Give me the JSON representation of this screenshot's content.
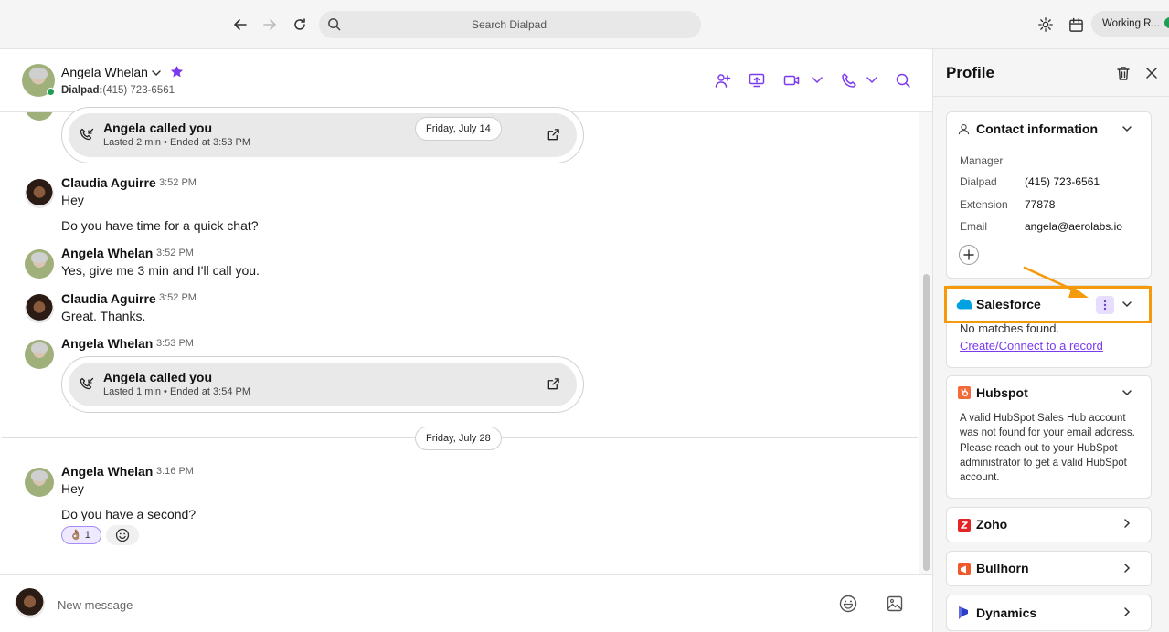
{
  "toolbar": {
    "search_placeholder": "Search Dialpad",
    "status_label": "Working R..."
  },
  "contact": {
    "name": "Angela Whelan",
    "line_label": "Dialpad:",
    "line_number": "(415) 723-6561"
  },
  "messages": {
    "call1": {
      "title": "Angela called you",
      "detail": "Lasted 2 min • Ended at 3:53 PM",
      "date": "Friday, July 14"
    },
    "m1": {
      "sender": "Claudia Aguirre",
      "time": "3:52 PM",
      "lines": [
        "Hey",
        "Do you have time for a quick chat?"
      ]
    },
    "m2": {
      "sender": "Angela Whelan",
      "time": "3:52 PM",
      "lines": [
        "Yes, give me 3 min and I'll call you."
      ]
    },
    "m3": {
      "sender": "Claudia Aguirre",
      "time": "3:52 PM",
      "lines": [
        "Great. Thanks."
      ]
    },
    "m4": {
      "sender": "Angela Whelan",
      "time": "3:53 PM"
    },
    "call2": {
      "title": "Angela called you",
      "detail": "Lasted 1 min • Ended at 3:54 PM"
    },
    "date_divider": "Friday, July 28",
    "m5": {
      "sender": "Angela Whelan",
      "time": "3:16 PM",
      "lines": [
        "Hey",
        "Do you have a second?"
      ]
    },
    "reaction": {
      "emoji": "👌🏽",
      "count": "1"
    }
  },
  "composer": {
    "placeholder": "New message"
  },
  "profile": {
    "title": "Profile",
    "contact_info": {
      "title": "Contact information",
      "role": "Manager",
      "fields": [
        {
          "label": "Dialpad",
          "value": "(415) 723-6561"
        },
        {
          "label": "Extension",
          "value": "77878"
        },
        {
          "label": "Email",
          "value": "angela@aerolabs.io"
        }
      ]
    },
    "salesforce": {
      "title": "Salesforce",
      "status": "No matches found.",
      "link": "Create/Connect to a record"
    },
    "hubspot": {
      "title": "Hubspot",
      "message": "A valid HubSpot Sales Hub account was not found for your email address. Please reach out to your HubSpot administrator to get a valid HubSpot account."
    },
    "integrations": [
      {
        "title": "Zoho"
      },
      {
        "title": "Bullhorn"
      },
      {
        "title": "Dynamics"
      }
    ]
  },
  "colors": {
    "accent": "#7c3aed",
    "highlight": "#f59a0a",
    "online": "#1f9d55"
  }
}
